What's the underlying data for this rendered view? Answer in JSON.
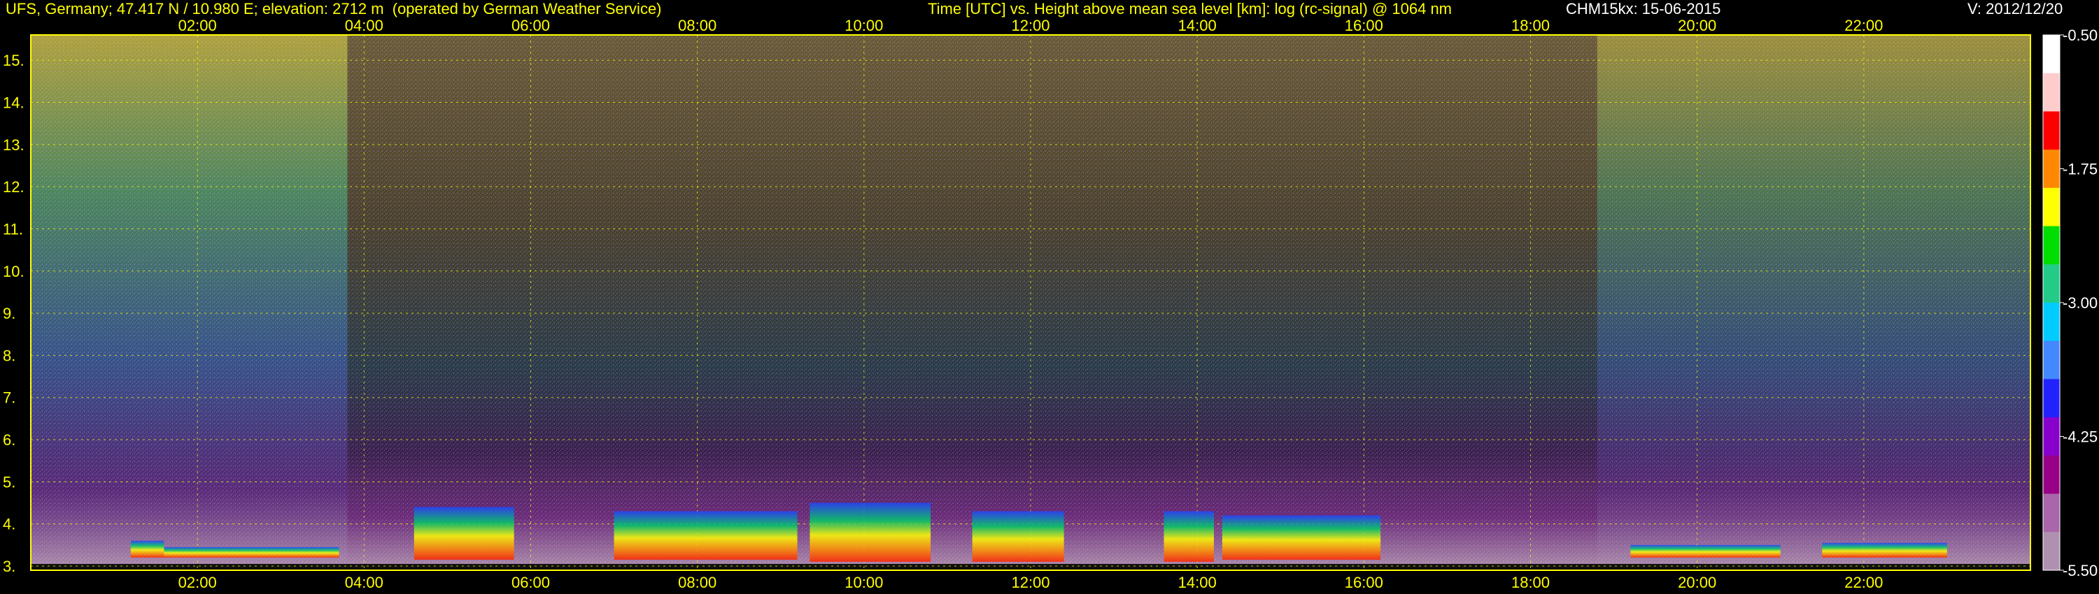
{
  "header": {
    "station": "UFS, Germany; 47.417 N / 10.980 E; elevation: 2712 m  (operated by German Weather Service)",
    "title": "Time [UTC] vs. Height above mean sea level [km]: log (rc-signal) @ 1064 nm",
    "instrument": "CHM15kx: 15-06-2015",
    "version": "V: 2012/12/20"
  },
  "chart_data": {
    "type": "heatmap",
    "title": "Time [UTC] vs. Height above mean sea level [km]: log (rc-signal) @ 1064 nm",
    "xlabel": "Time [UTC]",
    "ylabel": "Height above mean sea level [km]",
    "x_ticks": [
      "02:00",
      "04:00",
      "06:00",
      "08:00",
      "10:00",
      "12:00",
      "14:00",
      "16:00",
      "18:00",
      "20:00",
      "22:00"
    ],
    "x_tick_hours": [
      2,
      4,
      6,
      8,
      10,
      12,
      14,
      16,
      18,
      20,
      22
    ],
    "xlim_hours": [
      0,
      24
    ],
    "y_ticks": [
      "3.",
      "4.",
      "5.",
      "6.",
      "7.",
      "8.",
      "9.",
      "10.",
      "11.",
      "12.",
      "13.",
      "14.",
      "15."
    ],
    "y_tick_values": [
      3,
      4,
      5,
      6,
      7,
      8,
      9,
      10,
      11,
      12,
      13,
      14,
      15
    ],
    "ylim": [
      2.9,
      15.6
    ],
    "grid": true,
    "colorbar": {
      "ticks": [
        "-0.50",
        "-1.75",
        "-3.00",
        "-4.25",
        "-5.50"
      ],
      "tick_values": [
        -0.5,
        -1.75,
        -3.0,
        -4.25,
        -5.5
      ],
      "range": [
        -5.5,
        -0.5
      ],
      "colors": [
        "#ffffff",
        "#ffcccc",
        "#ff0000",
        "#ff8800",
        "#ffff00",
        "#00dd00",
        "#22cc88",
        "#00ccff",
        "#4488ff",
        "#2222ff",
        "#8800cc",
        "#990088",
        "#aa66aa",
        "#b090b0"
      ]
    },
    "cloud_layers": [
      {
        "start_h": 1.2,
        "end_h": 1.6,
        "base_km": 3.2,
        "top_km": 3.6
      },
      {
        "start_h": 1.6,
        "end_h": 3.7,
        "base_km": 3.2,
        "top_km": 3.45
      },
      {
        "start_h": 4.6,
        "end_h": 5.8,
        "base_km": 3.15,
        "top_km": 4.4
      },
      {
        "start_h": 7.0,
        "end_h": 9.2,
        "base_km": 3.15,
        "top_km": 4.3
      },
      {
        "start_h": 9.35,
        "end_h": 10.8,
        "base_km": 3.1,
        "top_km": 4.5
      },
      {
        "start_h": 11.3,
        "end_h": 12.4,
        "base_km": 3.1,
        "top_km": 4.3
      },
      {
        "start_h": 13.6,
        "end_h": 14.2,
        "base_km": 3.1,
        "top_km": 4.3
      },
      {
        "start_h": 14.3,
        "end_h": 16.2,
        "base_km": 3.15,
        "top_km": 4.2
      },
      {
        "start_h": 19.2,
        "end_h": 21.0,
        "base_km": 3.2,
        "top_km": 3.5
      },
      {
        "start_h": 21.5,
        "end_h": 23.0,
        "base_km": 3.2,
        "top_km": 3.55
      }
    ]
  }
}
